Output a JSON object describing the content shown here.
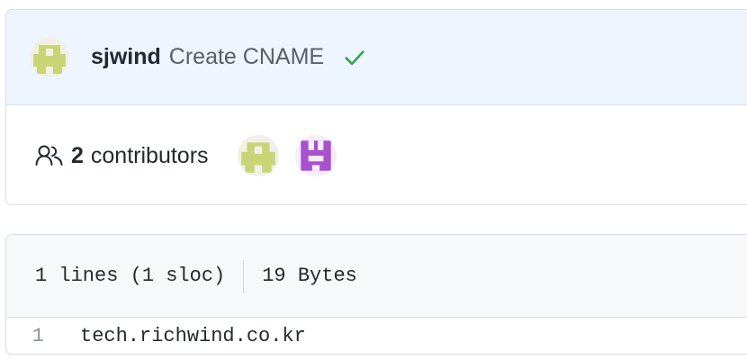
{
  "commit": {
    "author": "sjwind",
    "message": "Create CNAME",
    "status_icon": "check-icon",
    "status_color": "#2da44e"
  },
  "contributors": {
    "count": "2",
    "label": "contributors"
  },
  "file": {
    "lines_info": "1 lines (1 sloc)",
    "size": "19 Bytes",
    "lines": [
      {
        "number": "1",
        "code": "tech.richwind.co.kr"
      }
    ]
  },
  "colors": {
    "header_bg": "#eef5ff",
    "avatar_green": "#c9d475",
    "avatar_purple": "#a94fcf"
  }
}
